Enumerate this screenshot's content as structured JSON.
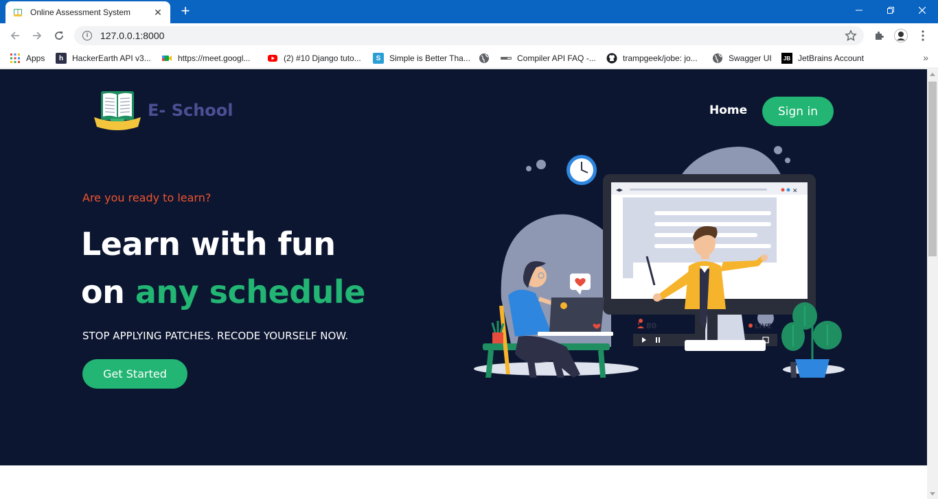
{
  "browser": {
    "tab_title": "Online Assessment System",
    "url": "127.0.0.1:8000",
    "bookmarks": [
      {
        "label": "Apps",
        "icon": "apps-grid-icon"
      },
      {
        "label": "HackerEarth API v3...",
        "icon": "hackerearth-icon"
      },
      {
        "label": "https://meet.googl...",
        "icon": "google-meet-icon"
      },
      {
        "label": "(2) #10 Django tuto...",
        "icon": "youtube-icon"
      },
      {
        "label": "Simple is Better Tha...",
        "icon": "s-icon"
      },
      {
        "label": "",
        "icon": "globe-icon"
      },
      {
        "label": "Compiler API FAQ -...",
        "icon": "compiler-icon"
      },
      {
        "label": "trampgeek/jobe: jo...",
        "icon": "github-icon"
      },
      {
        "label": "Swagger UI",
        "icon": "globe-icon"
      },
      {
        "label": "JetBrains Account",
        "icon": "jetbrains-icon"
      }
    ]
  },
  "header": {
    "brand": "E- School",
    "nav_home": "Home",
    "signin_label": "Sign in"
  },
  "hero": {
    "tagline": "Are you ready to learn?",
    "headline_line1": "Learn with fun",
    "headline_line2_prefix": "on ",
    "headline_line2_accent": "any schedule",
    "subheadline": "STOP APPLYING PATCHES. RECODE YOURSELF NOW.",
    "cta_label": "Get Started"
  },
  "illustration": {
    "viewer_count": "80",
    "live_label": "LIVE"
  },
  "colors": {
    "hero_bg": "#0c1631",
    "accent_green": "#22b573",
    "tagline_orange": "#f0542d",
    "chrome_blue": "#0a64c2"
  }
}
